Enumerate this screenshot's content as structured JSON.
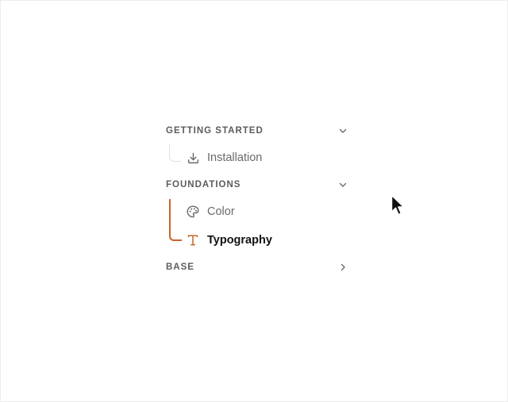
{
  "sections": [
    {
      "title": "GETTING STARTED",
      "expanded": true,
      "items": [
        {
          "label": "Installation",
          "icon": "download-icon",
          "active": false
        }
      ]
    },
    {
      "title": "FOUNDATIONS",
      "expanded": true,
      "items": [
        {
          "label": "Color",
          "icon": "palette-icon",
          "active": false
        },
        {
          "label": "Typography",
          "icon": "type-icon",
          "active": true
        }
      ]
    },
    {
      "title": "BASE",
      "expanded": false,
      "items": []
    }
  ],
  "colors": {
    "accent": "#c9652a",
    "section_text": "#5c5c5c",
    "item_text": "#6a6a6a",
    "active_text": "#111111",
    "tree_line": "#e2e2e2"
  }
}
